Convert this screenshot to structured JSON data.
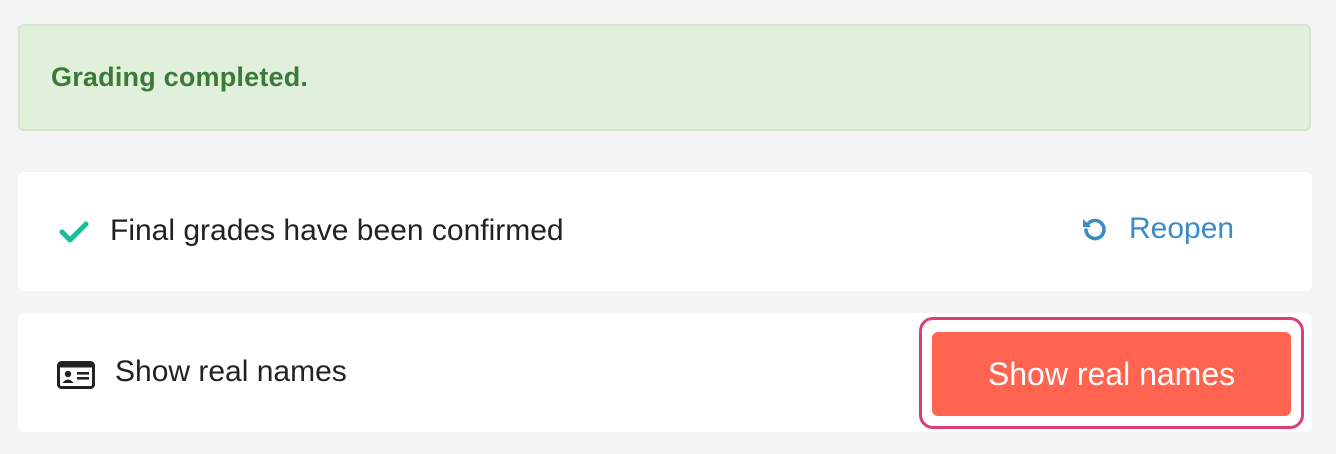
{
  "alert": {
    "text": "Grading completed."
  },
  "grades_row": {
    "icon": "check-icon",
    "label": "Final grades have been confirmed",
    "action_label": "Reopen",
    "action_icon": "undo-icon"
  },
  "names_row": {
    "icon": "id-card-icon",
    "label": "Show real names",
    "button_label": "Show real names"
  },
  "colors": {
    "alert_bg": "#e1f0da",
    "alert_text": "#3b7a3a",
    "check": "#1abc9c",
    "link": "#3a8cc4",
    "button_bg": "#ff6450",
    "focus_ring": "#dc3e7a"
  }
}
